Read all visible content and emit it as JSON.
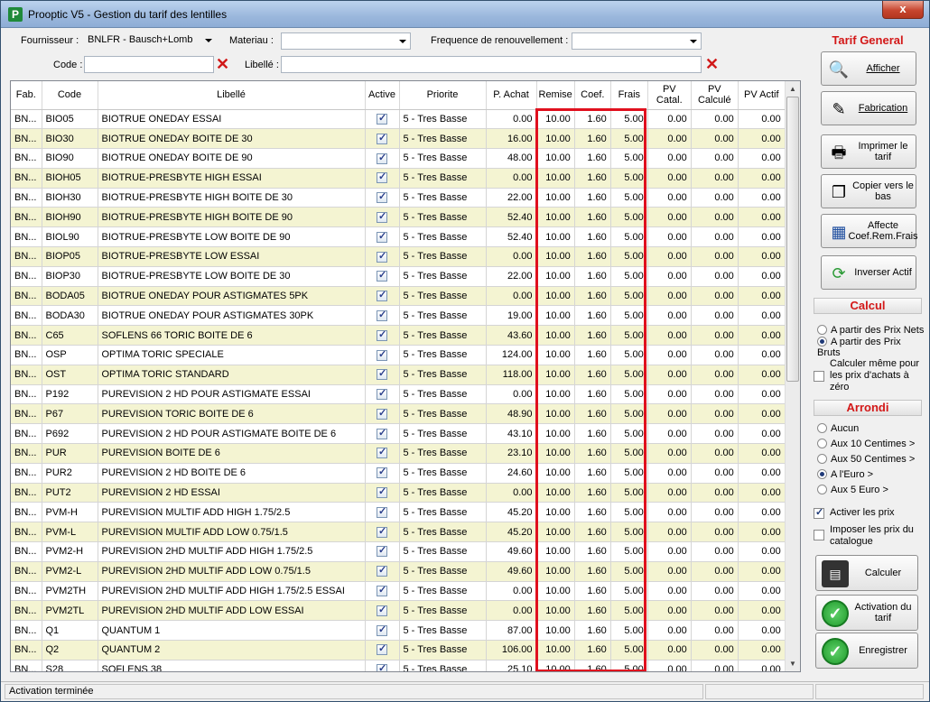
{
  "window": {
    "title": "Prooptic V5 - Gestion du tarif des lentilles",
    "close_glyph": "x",
    "app_glyph": "P"
  },
  "filters": {
    "fournisseur_label": "Fournisseur :",
    "fournisseur_value": "BNLFR - Bausch+Lomb",
    "materiau_label": "Materiau :",
    "materiau_value": "",
    "frequence_label": "Frequence de renouvellement :",
    "frequence_value": "",
    "code_label": "Code :",
    "code_value": "",
    "libelle_label": "Libellé :",
    "libelle_value": ""
  },
  "grid": {
    "columns": [
      "Fab.",
      "Code",
      "Libellé",
      "Active",
      "Priorite",
      "P. Achat",
      "Remise",
      "Coef.",
      "Frais",
      "PV Catal.",
      "PV Calculé",
      "PV Actif"
    ],
    "rows": [
      [
        "BN...",
        "BIO05",
        "BIOTRUE ONEDAY ESSAI",
        "5 - Tres Basse",
        "0.00",
        "10.00",
        "1.60",
        "5.00",
        "0.00",
        "0.00",
        "0.00"
      ],
      [
        "BN...",
        "BIO30",
        "BIOTRUE ONEDAY BOITE DE 30",
        "5 - Tres Basse",
        "16.00",
        "10.00",
        "1.60",
        "5.00",
        "0.00",
        "0.00",
        "0.00"
      ],
      [
        "BN...",
        "BIO90",
        "BIOTRUE ONEDAY BOITE DE 90",
        "5 - Tres Basse",
        "48.00",
        "10.00",
        "1.60",
        "5.00",
        "0.00",
        "0.00",
        "0.00"
      ],
      [
        "BN...",
        "BIOH05",
        "BIOTRUE-PRESBYTE HIGH ESSAI",
        "5 - Tres Basse",
        "0.00",
        "10.00",
        "1.60",
        "5.00",
        "0.00",
        "0.00",
        "0.00"
      ],
      [
        "BN...",
        "BIOH30",
        "BIOTRUE-PRESBYTE HIGH BOITE DE 30",
        "5 - Tres Basse",
        "22.00",
        "10.00",
        "1.60",
        "5.00",
        "0.00",
        "0.00",
        "0.00"
      ],
      [
        "BN...",
        "BIOH90",
        "BIOTRUE-PRESBYTE HIGH BOITE DE 90",
        "5 - Tres Basse",
        "52.40",
        "10.00",
        "1.60",
        "5.00",
        "0.00",
        "0.00",
        "0.00"
      ],
      [
        "BN...",
        "BIOL90",
        "BIOTRUE-PRESBYTE LOW BOITE DE 90",
        "5 - Tres Basse",
        "52.40",
        "10.00",
        "1.60",
        "5.00",
        "0.00",
        "0.00",
        "0.00"
      ],
      [
        "BN...",
        "BIOP05",
        "BIOTRUE-PRESBYTE LOW ESSAI",
        "5 - Tres Basse",
        "0.00",
        "10.00",
        "1.60",
        "5.00",
        "0.00",
        "0.00",
        "0.00"
      ],
      [
        "BN...",
        "BIOP30",
        "BIOTRUE-PRESBYTE LOW BOITE DE 30",
        "5 - Tres Basse",
        "22.00",
        "10.00",
        "1.60",
        "5.00",
        "0.00",
        "0.00",
        "0.00"
      ],
      [
        "BN...",
        "BODA05",
        "BIOTRUE ONEDAY POUR ASTIGMATES 5PK",
        "5 - Tres Basse",
        "0.00",
        "10.00",
        "1.60",
        "5.00",
        "0.00",
        "0.00",
        "0.00"
      ],
      [
        "BN...",
        "BODA30",
        "BIOTRUE ONEDAY POUR ASTIGMATES 30PK",
        "5 - Tres Basse",
        "19.00",
        "10.00",
        "1.60",
        "5.00",
        "0.00",
        "0.00",
        "0.00"
      ],
      [
        "BN...",
        "C65",
        "SOFLENS 66 TORIC BOITE DE 6",
        "5 - Tres Basse",
        "43.60",
        "10.00",
        "1.60",
        "5.00",
        "0.00",
        "0.00",
        "0.00"
      ],
      [
        "BN...",
        "OSP",
        "OPTIMA TORIC SPECIALE",
        "5 - Tres Basse",
        "124.00",
        "10.00",
        "1.60",
        "5.00",
        "0.00",
        "0.00",
        "0.00"
      ],
      [
        "BN...",
        "OST",
        "OPTIMA TORIC STANDARD",
        "5 - Tres Basse",
        "118.00",
        "10.00",
        "1.60",
        "5.00",
        "0.00",
        "0.00",
        "0.00"
      ],
      [
        "BN...",
        "P192",
        "PUREVISION 2 HD POUR ASTIGMATE ESSAI",
        "5 - Tres Basse",
        "0.00",
        "10.00",
        "1.60",
        "5.00",
        "0.00",
        "0.00",
        "0.00"
      ],
      [
        "BN...",
        "P67",
        "PUREVISION TORIC BOITE DE 6",
        "5 - Tres Basse",
        "48.90",
        "10.00",
        "1.60",
        "5.00",
        "0.00",
        "0.00",
        "0.00"
      ],
      [
        "BN...",
        "P692",
        "PUREVISION 2 HD POUR ASTIGMATE BOITE DE 6",
        "5 - Tres Basse",
        "43.10",
        "10.00",
        "1.60",
        "5.00",
        "0.00",
        "0.00",
        "0.00"
      ],
      [
        "BN...",
        "PUR",
        "PUREVISION BOITE DE 6",
        "5 - Tres Basse",
        "23.10",
        "10.00",
        "1.60",
        "5.00",
        "0.00",
        "0.00",
        "0.00"
      ],
      [
        "BN...",
        "PUR2",
        "PUREVISION  2 HD BOITE DE 6",
        "5 - Tres Basse",
        "24.60",
        "10.00",
        "1.60",
        "5.00",
        "0.00",
        "0.00",
        "0.00"
      ],
      [
        "BN...",
        "PUT2",
        "PUREVISION 2 HD ESSAI",
        "5 - Tres Basse",
        "0.00",
        "10.00",
        "1.60",
        "5.00",
        "0.00",
        "0.00",
        "0.00"
      ],
      [
        "BN...",
        "PVM-H",
        "PUREVISION MULTIF ADD HIGH 1.75/2.5",
        "5 - Tres Basse",
        "45.20",
        "10.00",
        "1.60",
        "5.00",
        "0.00",
        "0.00",
        "0.00"
      ],
      [
        "BN...",
        "PVM-L",
        "PUREVISION MULTIF ADD LOW 0.75/1.5",
        "5 - Tres Basse",
        "45.20",
        "10.00",
        "1.60",
        "5.00",
        "0.00",
        "0.00",
        "0.00"
      ],
      [
        "BN...",
        "PVM2-H",
        "PUREVISION 2HD MULTIF ADD HIGH 1.75/2.5",
        "5 - Tres Basse",
        "49.60",
        "10.00",
        "1.60",
        "5.00",
        "0.00",
        "0.00",
        "0.00"
      ],
      [
        "BN...",
        "PVM2-L",
        "PUREVISION 2HD MULTIF ADD LOW 0.75/1.5",
        "5 - Tres Basse",
        "49.60",
        "10.00",
        "1.60",
        "5.00",
        "0.00",
        "0.00",
        "0.00"
      ],
      [
        "BN...",
        "PVM2TH",
        "PUREVISION 2HD MULTIF ADD HIGH 1.75/2.5 ESSAI",
        "5 - Tres Basse",
        "0.00",
        "10.00",
        "1.60",
        "5.00",
        "0.00",
        "0.00",
        "0.00"
      ],
      [
        "BN...",
        "PVM2TL",
        "PUREVISION 2HD MULTIF ADD LOW ESSAI",
        "5 - Tres Basse",
        "0.00",
        "10.00",
        "1.60",
        "5.00",
        "0.00",
        "0.00",
        "0.00"
      ],
      [
        "BN...",
        "Q1",
        "QUANTUM 1",
        "5 - Tres Basse",
        "87.00",
        "10.00",
        "1.60",
        "5.00",
        "0.00",
        "0.00",
        "0.00"
      ],
      [
        "BN...",
        "Q2",
        "QUANTUM 2",
        "5 - Tres Basse",
        "106.00",
        "10.00",
        "1.60",
        "5.00",
        "0.00",
        "0.00",
        "0.00"
      ],
      [
        "BN...",
        "S28",
        "SOFLENS 38",
        "5 - Tres Basse",
        "25.10",
        "10.00",
        "1.60",
        "5.00",
        "0.00",
        "0.00",
        "0.00"
      ]
    ]
  },
  "panel": {
    "title": "Tarif General",
    "buttons": {
      "afficher": "Afficher",
      "fabrication": "Fabrication",
      "imprimer": "Imprimer le tarif",
      "copier": "Copier vers le bas",
      "affecte": "Affecte Coef.Rem.Frais",
      "inverser": "Inverser Actif"
    },
    "calcul": {
      "header": "Calcul",
      "opt_nets": "A partir des Prix Nets",
      "opt_bruts": "A partir des Prix Bruts",
      "zero_label": "Calculer même pour les prix d'achats à zéro"
    },
    "arrondi": {
      "header": "Arrondi",
      "aucun": "Aucun",
      "c10": "Aux 10 Centimes >",
      "c50": "Aux 50 Centimes >",
      "euro": "A l'Euro >",
      "euro5": "Aux 5 Euro >"
    },
    "activer_prix": "Activer les prix",
    "imposer_prix": "Imposer les prix du catalogue",
    "calculer": "Calculer",
    "activation": "Activation du tarif",
    "enregistrer": "Enregistrer"
  },
  "status": {
    "message": "Activation terminée"
  },
  "colors": {
    "highlight": "#e0101e",
    "accent_red": "#d31818",
    "alt_row": "#f4f4d2"
  }
}
